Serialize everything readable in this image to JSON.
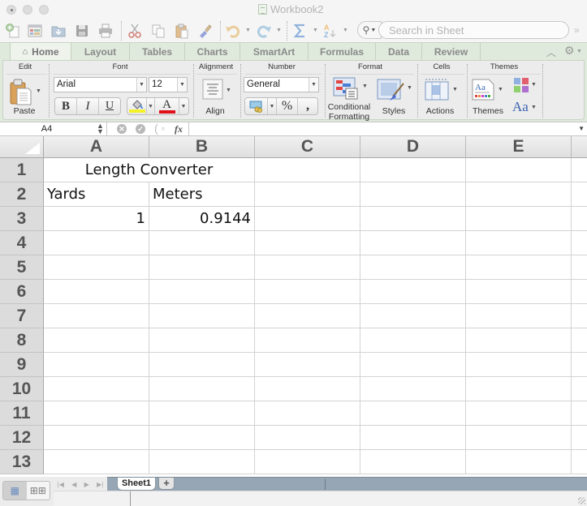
{
  "window": {
    "title": "Workbook2"
  },
  "toolbar": {
    "icons": [
      "new-workbook-icon",
      "templates-icon",
      "open-icon",
      "save-icon",
      "print-icon",
      "cut-icon",
      "copy-icon",
      "paste-icon",
      "format-painter-icon",
      "undo-icon",
      "redo-icon",
      "autosum-icon",
      "sort-icon"
    ],
    "search_placeholder": "Search in Sheet",
    "overflow_glyph": "»"
  },
  "ribbon": {
    "tabs": [
      {
        "label": "Home",
        "active": true
      },
      {
        "label": "Layout",
        "active": false
      },
      {
        "label": "Tables",
        "active": false
      },
      {
        "label": "Charts",
        "active": false
      },
      {
        "label": "SmartArt",
        "active": false
      },
      {
        "label": "Formulas",
        "active": false
      },
      {
        "label": "Data",
        "active": false
      },
      {
        "label": "Review",
        "active": false
      }
    ],
    "groups": {
      "edit": {
        "label": "Edit",
        "paste_label": "Paste"
      },
      "font": {
        "label": "Font",
        "font_name": "Arial",
        "font_size": "12",
        "bold": "B",
        "italic": "I",
        "underline": "U",
        "fill_color": "#f5f22a",
        "font_color": "#e0101a",
        "font_color_glyph": "A"
      },
      "alignment": {
        "label": "Alignment",
        "align_label": "Align"
      },
      "number": {
        "label": "Number",
        "format": "General",
        "percent": "%",
        "comma": ","
      },
      "format": {
        "label": "Format",
        "conditional_label_1": "Conditional",
        "conditional_label_2": "Formatting",
        "styles_label": "Styles"
      },
      "cells": {
        "label": "Cells",
        "actions_label": "Actions"
      },
      "themes": {
        "label": "Themes",
        "themes_label": "Themes",
        "fonts_glyph": "Aa"
      }
    }
  },
  "formula_bar": {
    "name_box": "A4",
    "fx_label": "fx",
    "formula": ""
  },
  "sheet": {
    "columns": [
      "A",
      "B",
      "C",
      "D",
      "E"
    ],
    "rows": [
      "1",
      "2",
      "3",
      "4",
      "5",
      "6",
      "7",
      "8",
      "9",
      "10",
      "11",
      "12",
      "13"
    ],
    "cells": {
      "A1_B1": "Length Converter",
      "A2": "Yards",
      "B2": "Meters",
      "A3": "1",
      "B3": "0.9144"
    },
    "active_cell": "A4"
  },
  "sheet_tabs": {
    "tabs": [
      "Sheet1"
    ],
    "add_label": "+",
    "nav": [
      "|◀",
      "◀",
      "▶",
      "▶|"
    ]
  }
}
